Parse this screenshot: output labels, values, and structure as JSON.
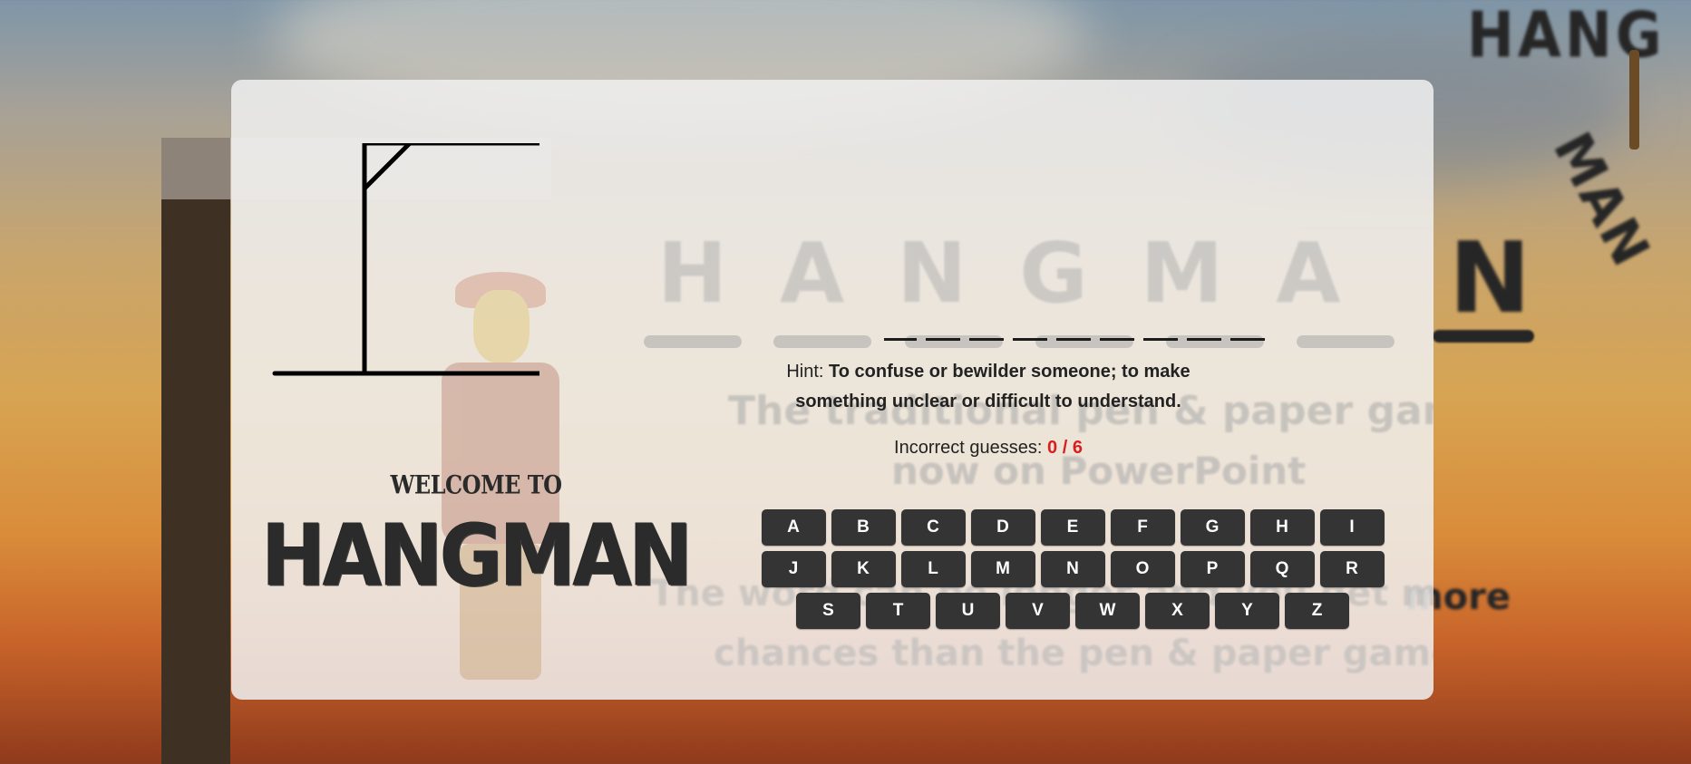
{
  "background": {
    "poster_word_hang": "HANG",
    "poster_word_man": "MAN",
    "poster_letter_n": "N",
    "poster_text_more": "more"
  },
  "poster_ghost": {
    "letters": "HANGMA",
    "line1": "The traditional pen & paper game",
    "line2": "now on PowerPoint",
    "line3": "The word can be longer and you get more",
    "line4": "chances than the pen & paper game"
  },
  "title": {
    "welcome": "WELCOME TO",
    "name": "HANGMAN"
  },
  "word": {
    "slots": [
      "_",
      "_",
      "_",
      "_",
      "_",
      "_",
      "_",
      "_",
      "_"
    ]
  },
  "hint": {
    "label": "Hint:",
    "text": "To confuse or bewilder someone; to make something unclear or difficult to understand."
  },
  "incorrect": {
    "label": "Incorrect guesses:",
    "count": "0 / 6"
  },
  "keyboard": {
    "row1": [
      "A",
      "B",
      "C",
      "D",
      "E",
      "F",
      "G",
      "H",
      "I"
    ],
    "row2": [
      "J",
      "K",
      "L",
      "M",
      "N",
      "O",
      "P",
      "Q",
      "R"
    ],
    "row3": [
      "S",
      "T",
      "U",
      "V",
      "W",
      "X",
      "Y",
      "Z"
    ]
  },
  "colors": {
    "key_bg": "#343434",
    "key_text": "#ffffff",
    "count_red": "#d71f1f",
    "card_bg": "#f0f0f0"
  }
}
